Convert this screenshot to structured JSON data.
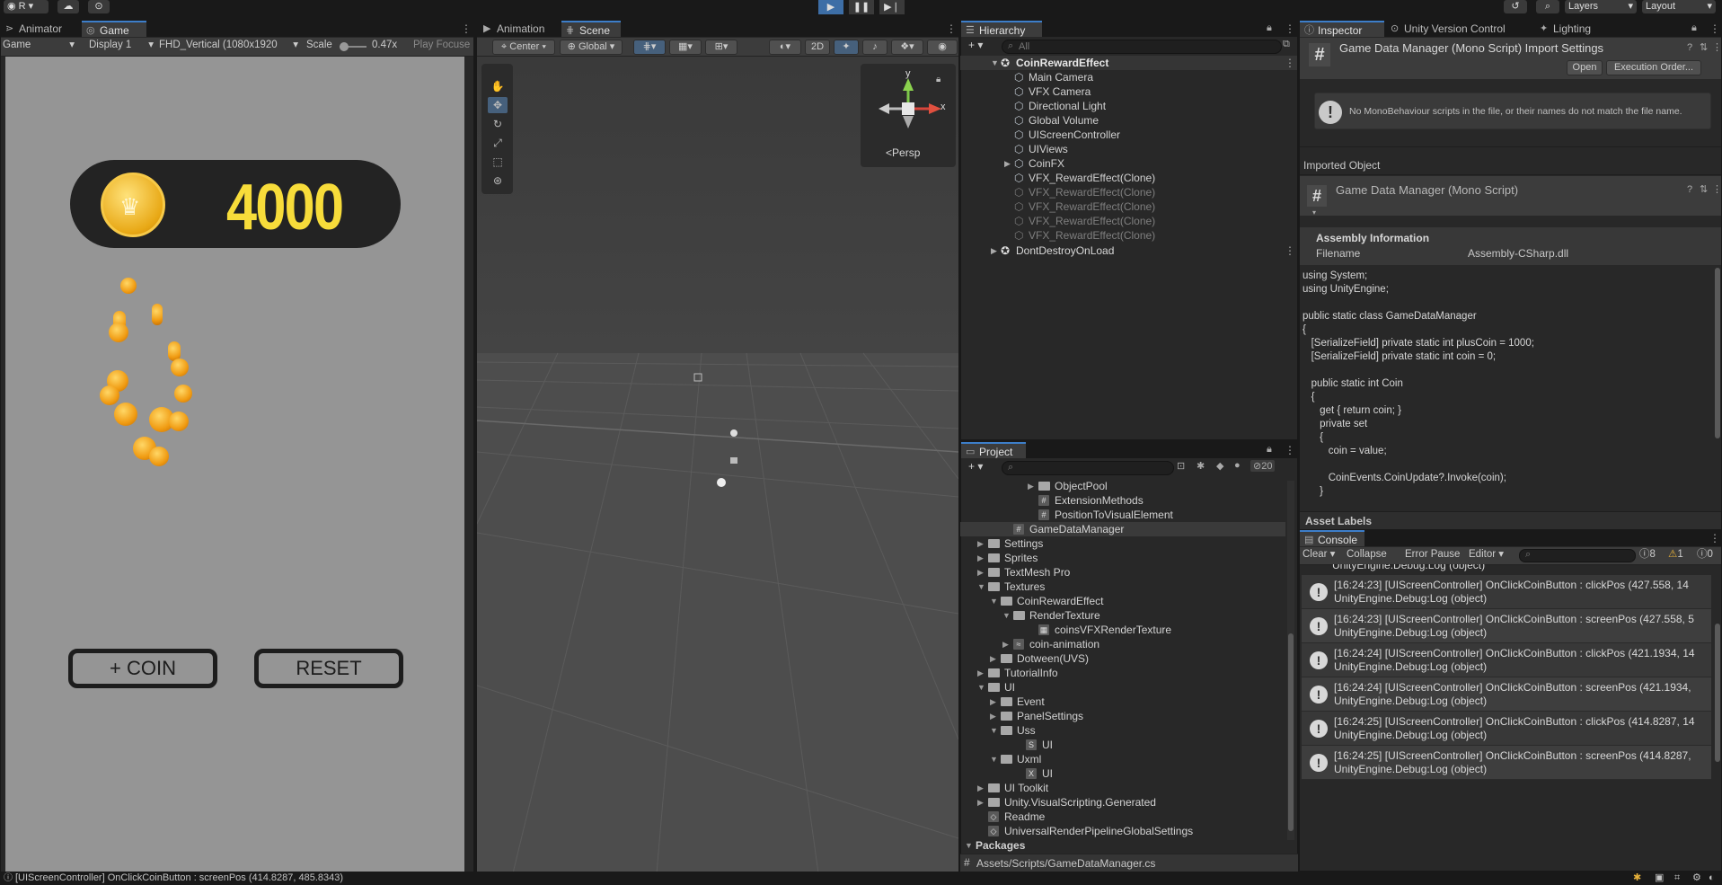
{
  "toolbar": {
    "account": "R",
    "layers": "Layers",
    "layout": "Layout"
  },
  "game_panel": {
    "tabs": [
      "Animator",
      "Game"
    ],
    "display_mode": "Game",
    "display": "Display 1",
    "resolution": "FHD_Vertical (1080x1920",
    "scale_label": "Scale",
    "scale_value": "0.47x",
    "play_focused": "Play Focuse",
    "coin_count": "4000",
    "coin_button": "+ COIN",
    "reset_button": "RESET"
  },
  "scene_panel": {
    "tabs": [
      "Animation",
      "Scene"
    ],
    "pivot": "Center",
    "space": "Global",
    "mode_2d": "2D",
    "gizmo_label": "Persp",
    "axis_y": "y",
    "axis_x": "x"
  },
  "hierarchy": {
    "title": "Hierarchy",
    "search_placeholder": "All",
    "root": "CoinRewardEffect",
    "items": [
      {
        "label": "Main Camera",
        "dim": false
      },
      {
        "label": "VFX Camera",
        "dim": false
      },
      {
        "label": "Directional Light",
        "dim": false
      },
      {
        "label": "Global Volume",
        "dim": false
      },
      {
        "label": "UIScreenController",
        "dim": false
      },
      {
        "label": "UIViews",
        "dim": false
      },
      {
        "label": "CoinFX",
        "dim": false
      },
      {
        "label": "VFX_RewardEffect(Clone)",
        "dim": false
      },
      {
        "label": "VFX_RewardEffect(Clone)",
        "dim": true
      },
      {
        "label": "VFX_RewardEffect(Clone)",
        "dim": true
      },
      {
        "label": "VFX_RewardEffect(Clone)",
        "dim": true
      },
      {
        "label": "VFX_RewardEffect(Clone)",
        "dim": true
      }
    ],
    "second_root": "DontDestroyOnLoad"
  },
  "project": {
    "title": "Project",
    "hidden_count": "20",
    "items": [
      "ObjectPool",
      "ExtensionMethods",
      "PositionToVisualElement",
      "GameDataManager",
      "Settings",
      "Sprites",
      "TextMesh Pro",
      "Textures",
      "CoinRewardEffect",
      "RenderTexture",
      "coinsVFXRenderTexture",
      "coin-animation",
      "Dotween(UVS)",
      "TutorialInfo",
      "UI",
      "Event",
      "PanelSettings",
      "Uss",
      "UI",
      "Uxml",
      "UI",
      "UI Toolkit",
      "Unity.VisualScripting.Generated",
      "Readme",
      "UniversalRenderPipelineGlobalSettings",
      "Packages"
    ],
    "path": "Assets/Scripts/GameDataManager.cs"
  },
  "inspector": {
    "tabs": [
      "Inspector",
      "Unity Version Control",
      "Lighting"
    ],
    "header_title": "Game Data Manager (Mono Script) Import Settings",
    "open_button": "Open",
    "execution_order_button": "Execution Order...",
    "warning": "No MonoBehaviour scripts in the file, or their names do not match the file name.",
    "imported_object": "Imported Object",
    "object_title": "Game Data Manager (Mono Script)",
    "assembly_info": "Assembly Information",
    "filename_label": "Filename",
    "filename_value": "Assembly-CSharp.dll",
    "code": "using System;\nusing UnityEngine;\n\npublic static class GameDataManager\n{\n   [SerializeField] private static int plusCoin = 1000;\n   [SerializeField] private static int coin = 0;\n\n   public static int Coin\n   {\n      get { return coin; }\n      private set\n      {\n         coin = value;\n\n         CoinEvents.CoinUpdate?.Invoke(coin);\n      }",
    "asset_labels": "Asset Labels"
  },
  "console": {
    "title": "Console",
    "clear": "Clear",
    "collapse": "Collapse",
    "error_pause": "Error Pause",
    "editor": "Editor",
    "count_info": "8",
    "count_warn": "1",
    "count_error": "0",
    "partial_line": "UnityEngine.Debug:Log (object)",
    "rows": [
      {
        "line1": "[16:24:23] [UIScreenController] OnClickCoinButton : clickPos (427.558, 14",
        "line2": "UnityEngine.Debug:Log (object)"
      },
      {
        "line1": "[16:24:23] [UIScreenController] OnClickCoinButton : screenPos (427.558, 5",
        "line2": "UnityEngine.Debug:Log (object)"
      },
      {
        "line1": "[16:24:24] [UIScreenController] OnClickCoinButton : clickPos (421.1934, 14",
        "line2": "UnityEngine.Debug:Log (object)"
      },
      {
        "line1": "[16:24:24] [UIScreenController] OnClickCoinButton : screenPos (421.1934,",
        "line2": "UnityEngine.Debug:Log (object)"
      },
      {
        "line1": "[16:24:25] [UIScreenController] OnClickCoinButton : clickPos (414.8287, 14",
        "line2": "UnityEngine.Debug:Log (object)"
      },
      {
        "line1": "[16:24:25] [UIScreenController] OnClickCoinButton : screenPos (414.8287,",
        "line2": "UnityEngine.Debug:Log (object)"
      }
    ]
  },
  "status": {
    "message": "[UIScreenController] OnClickCoinButton : screenPos (414.8287, 485.8343)"
  }
}
